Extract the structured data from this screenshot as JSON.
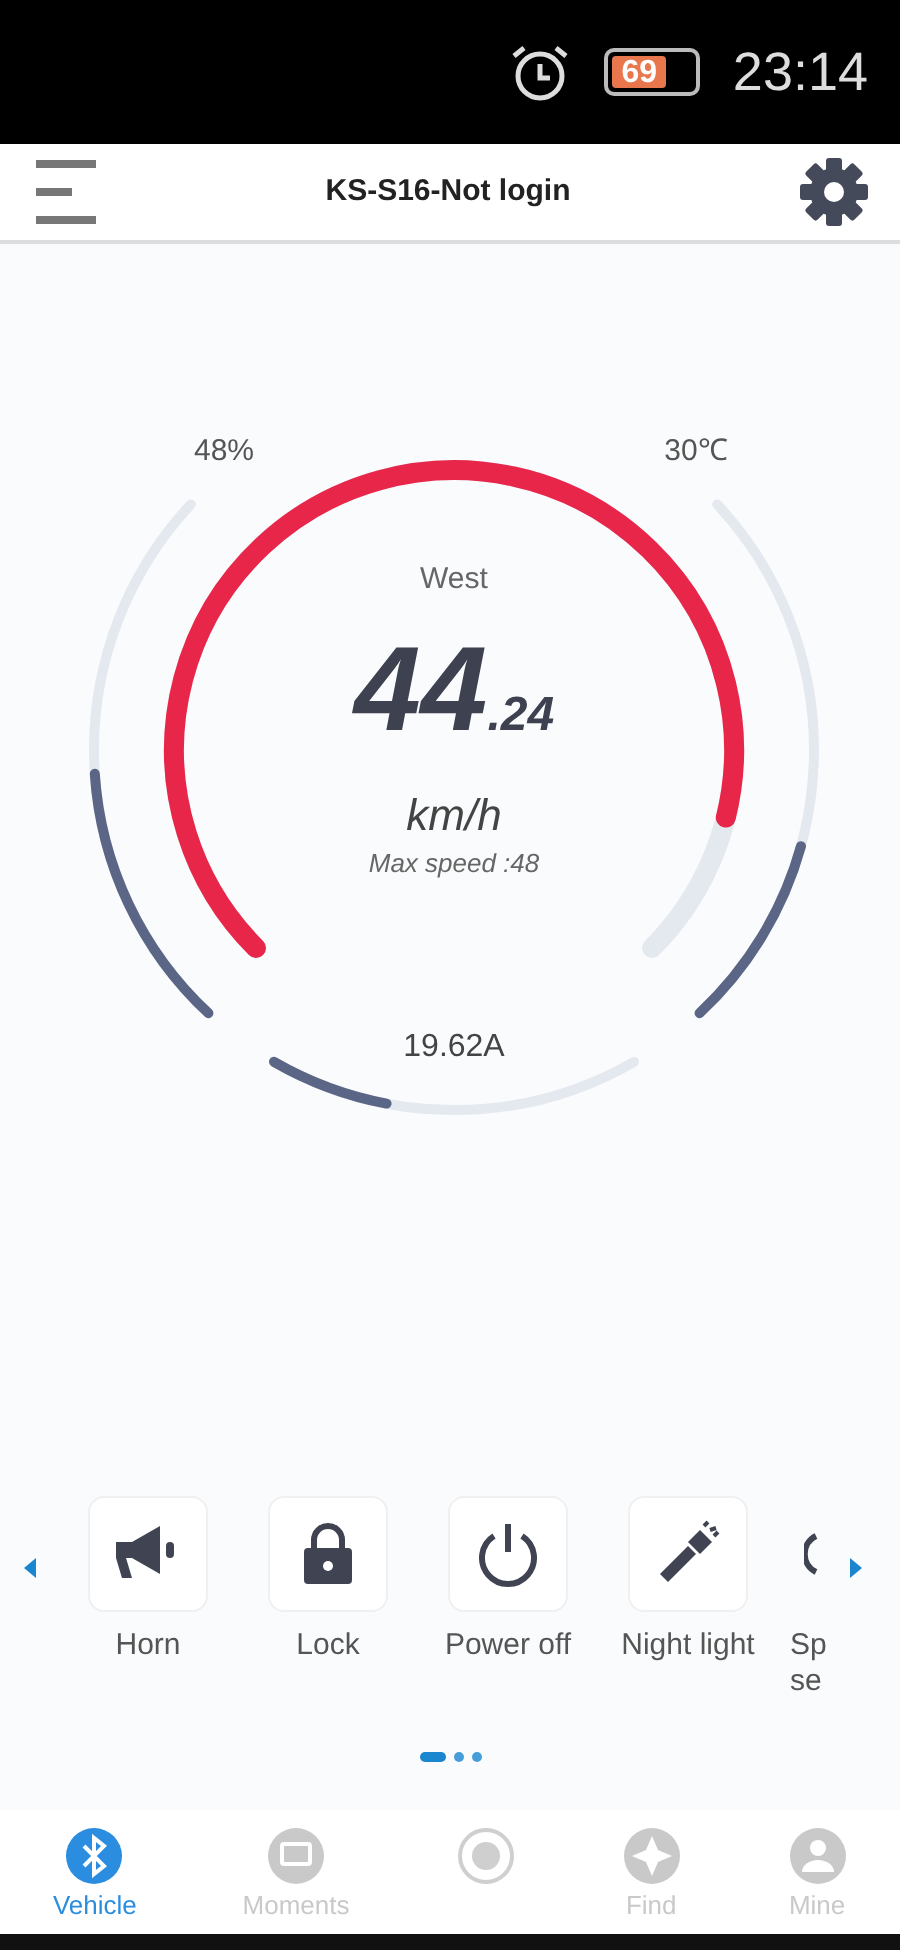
{
  "status_bar": {
    "battery": "69",
    "time": "23:14"
  },
  "header": {
    "title": "KS-S16-Not login"
  },
  "dashboard": {
    "direction": "West",
    "speed": "44",
    "speed_fraction": ".24",
    "unit": "km/h",
    "max_speed": "Max speed :48",
    "battery": {
      "reading": "48%"
    },
    "temperature": {
      "reading": "30℃"
    },
    "current": {
      "reading": "19.62A"
    }
  },
  "actions": [
    {
      "label": "Horn"
    },
    {
      "label": "Lock"
    },
    {
      "label": "Power off"
    },
    {
      "label": "Night light"
    },
    {
      "label": "Sp se"
    }
  ],
  "pages": [
    {
      "selected": true
    },
    {
      "selected": false
    },
    {
      "selected": false
    }
  ],
  "bottom_nav": [
    {
      "label": "Vehicle",
      "selected": true
    },
    {
      "label": "Moments",
      "selected": false
    },
    {
      "selected": false
    },
    {
      "label": "Find",
      "selected": false
    },
    {
      "label": "Mine",
      "selected": false
    }
  ]
}
